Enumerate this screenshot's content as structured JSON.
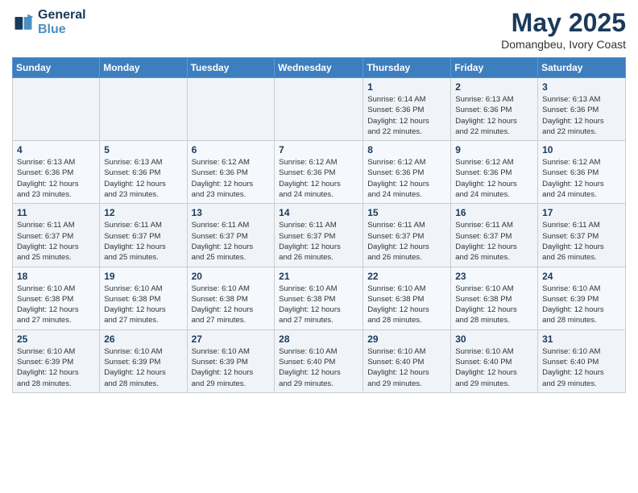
{
  "logo": {
    "line1": "General",
    "line2": "Blue"
  },
  "title": "May 2025",
  "subtitle": "Domangbeu, Ivory Coast",
  "days_header": [
    "Sunday",
    "Monday",
    "Tuesday",
    "Wednesday",
    "Thursday",
    "Friday",
    "Saturday"
  ],
  "weeks": [
    {
      "days": [
        {
          "num": "",
          "info": ""
        },
        {
          "num": "",
          "info": ""
        },
        {
          "num": "",
          "info": ""
        },
        {
          "num": "",
          "info": ""
        },
        {
          "num": "1",
          "info": "Sunrise: 6:14 AM\nSunset: 6:36 PM\nDaylight: 12 hours\nand 22 minutes."
        },
        {
          "num": "2",
          "info": "Sunrise: 6:13 AM\nSunset: 6:36 PM\nDaylight: 12 hours\nand 22 minutes."
        },
        {
          "num": "3",
          "info": "Sunrise: 6:13 AM\nSunset: 6:36 PM\nDaylight: 12 hours\nand 22 minutes."
        }
      ]
    },
    {
      "days": [
        {
          "num": "4",
          "info": "Sunrise: 6:13 AM\nSunset: 6:36 PM\nDaylight: 12 hours\nand 23 minutes."
        },
        {
          "num": "5",
          "info": "Sunrise: 6:13 AM\nSunset: 6:36 PM\nDaylight: 12 hours\nand 23 minutes."
        },
        {
          "num": "6",
          "info": "Sunrise: 6:12 AM\nSunset: 6:36 PM\nDaylight: 12 hours\nand 23 minutes."
        },
        {
          "num": "7",
          "info": "Sunrise: 6:12 AM\nSunset: 6:36 PM\nDaylight: 12 hours\nand 24 minutes."
        },
        {
          "num": "8",
          "info": "Sunrise: 6:12 AM\nSunset: 6:36 PM\nDaylight: 12 hours\nand 24 minutes."
        },
        {
          "num": "9",
          "info": "Sunrise: 6:12 AM\nSunset: 6:36 PM\nDaylight: 12 hours\nand 24 minutes."
        },
        {
          "num": "10",
          "info": "Sunrise: 6:12 AM\nSunset: 6:36 PM\nDaylight: 12 hours\nand 24 minutes."
        }
      ]
    },
    {
      "days": [
        {
          "num": "11",
          "info": "Sunrise: 6:11 AM\nSunset: 6:37 PM\nDaylight: 12 hours\nand 25 minutes."
        },
        {
          "num": "12",
          "info": "Sunrise: 6:11 AM\nSunset: 6:37 PM\nDaylight: 12 hours\nand 25 minutes."
        },
        {
          "num": "13",
          "info": "Sunrise: 6:11 AM\nSunset: 6:37 PM\nDaylight: 12 hours\nand 25 minutes."
        },
        {
          "num": "14",
          "info": "Sunrise: 6:11 AM\nSunset: 6:37 PM\nDaylight: 12 hours\nand 26 minutes."
        },
        {
          "num": "15",
          "info": "Sunrise: 6:11 AM\nSunset: 6:37 PM\nDaylight: 12 hours\nand 26 minutes."
        },
        {
          "num": "16",
          "info": "Sunrise: 6:11 AM\nSunset: 6:37 PM\nDaylight: 12 hours\nand 26 minutes."
        },
        {
          "num": "17",
          "info": "Sunrise: 6:11 AM\nSunset: 6:37 PM\nDaylight: 12 hours\nand 26 minutes."
        }
      ]
    },
    {
      "days": [
        {
          "num": "18",
          "info": "Sunrise: 6:10 AM\nSunset: 6:38 PM\nDaylight: 12 hours\nand 27 minutes."
        },
        {
          "num": "19",
          "info": "Sunrise: 6:10 AM\nSunset: 6:38 PM\nDaylight: 12 hours\nand 27 minutes."
        },
        {
          "num": "20",
          "info": "Sunrise: 6:10 AM\nSunset: 6:38 PM\nDaylight: 12 hours\nand 27 minutes."
        },
        {
          "num": "21",
          "info": "Sunrise: 6:10 AM\nSunset: 6:38 PM\nDaylight: 12 hours\nand 27 minutes."
        },
        {
          "num": "22",
          "info": "Sunrise: 6:10 AM\nSunset: 6:38 PM\nDaylight: 12 hours\nand 28 minutes."
        },
        {
          "num": "23",
          "info": "Sunrise: 6:10 AM\nSunset: 6:38 PM\nDaylight: 12 hours\nand 28 minutes."
        },
        {
          "num": "24",
          "info": "Sunrise: 6:10 AM\nSunset: 6:39 PM\nDaylight: 12 hours\nand 28 minutes."
        }
      ]
    },
    {
      "days": [
        {
          "num": "25",
          "info": "Sunrise: 6:10 AM\nSunset: 6:39 PM\nDaylight: 12 hours\nand 28 minutes."
        },
        {
          "num": "26",
          "info": "Sunrise: 6:10 AM\nSunset: 6:39 PM\nDaylight: 12 hours\nand 28 minutes."
        },
        {
          "num": "27",
          "info": "Sunrise: 6:10 AM\nSunset: 6:39 PM\nDaylight: 12 hours\nand 29 minutes."
        },
        {
          "num": "28",
          "info": "Sunrise: 6:10 AM\nSunset: 6:40 PM\nDaylight: 12 hours\nand 29 minutes."
        },
        {
          "num": "29",
          "info": "Sunrise: 6:10 AM\nSunset: 6:40 PM\nDaylight: 12 hours\nand 29 minutes."
        },
        {
          "num": "30",
          "info": "Sunrise: 6:10 AM\nSunset: 6:40 PM\nDaylight: 12 hours\nand 29 minutes."
        },
        {
          "num": "31",
          "info": "Sunrise: 6:10 AM\nSunset: 6:40 PM\nDaylight: 12 hours\nand 29 minutes."
        }
      ]
    }
  ]
}
